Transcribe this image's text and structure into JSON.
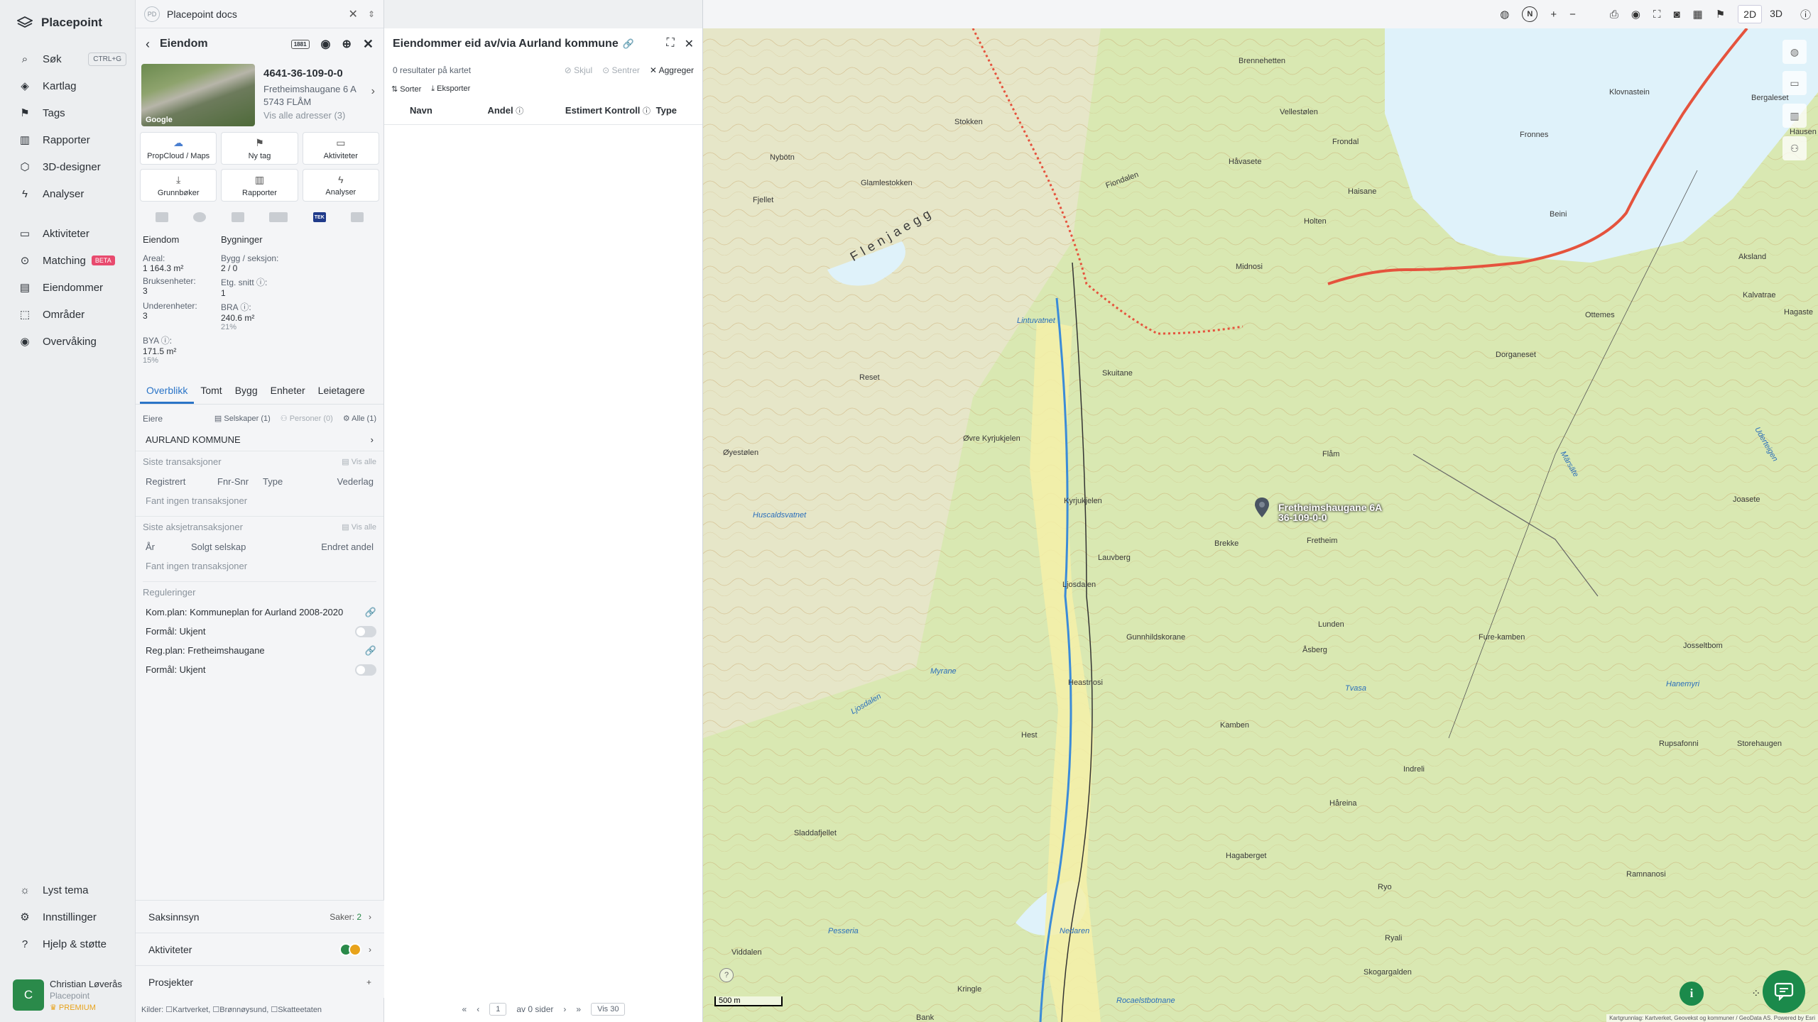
{
  "app": {
    "name": "Placepoint"
  },
  "nav": {
    "items": [
      {
        "label": "Søk",
        "shortcut": "CTRL+G"
      },
      {
        "label": "Kartlag"
      },
      {
        "label": "Tags"
      },
      {
        "label": "Rapporter"
      },
      {
        "label": "3D-designer"
      },
      {
        "label": "Analyser"
      }
    ],
    "items2": [
      {
        "label": "Aktiviteter"
      },
      {
        "label": "Matching",
        "badge": "BETA"
      },
      {
        "label": "Eiendommer"
      },
      {
        "label": "Områder"
      },
      {
        "label": "Overvåking"
      }
    ],
    "bottom": [
      {
        "label": "Lyst tema"
      },
      {
        "label": "Innstillinger"
      },
      {
        "label": "Hjelp & støtte"
      }
    ]
  },
  "user": {
    "initial": "C",
    "name": "Christian Løverås",
    "org": "Placepoint",
    "plan": "PREMIUM"
  },
  "docs": {
    "badge": "PD",
    "title": "Placepoint docs"
  },
  "property": {
    "header": "Eiendom",
    "header_badge": "1881",
    "id": "4641-36-109-0-0",
    "address": "Fretheimshaugane 6 A",
    "postal": "5743 FLÅM",
    "all_addresses": "Vis alle adresser (3)",
    "photo_credit": "Google",
    "actions": [
      {
        "label": "PropCloud / Maps",
        "icon": "cloud-icon"
      },
      {
        "label": "Ny tag",
        "icon": "bookmark-icon"
      },
      {
        "label": "Aktiviteter",
        "icon": "chat-icon"
      },
      {
        "label": "Grunnbøker",
        "icon": "download-icon"
      },
      {
        "label": "Rapporter",
        "icon": "chart-icon"
      },
      {
        "label": "Analyser",
        "icon": "analysis-icon"
      }
    ],
    "tek_label": "TEK",
    "stats": {
      "col1_title": "Eiendom",
      "col2_title": "Bygninger",
      "areal_label": "Areal:",
      "areal": "1 164.3 m²",
      "bygg_label": "Bygg / seksjon:",
      "bygg": "2 / 0",
      "bruks_label": "Bruksenheter:",
      "bruks": "3",
      "etg_label": "Etg. snitt ⓘ:",
      "etg": "1",
      "under_label": "Underenheter:",
      "under": "3",
      "bra_label": "BRA ⓘ:",
      "bra": "240.6 m²",
      "bra_pct": "21%",
      "bya_label": "BYA ⓘ:",
      "bya": "171.5 m²",
      "bya_pct": "15%"
    },
    "tabs": [
      "Overblikk",
      "Tomt",
      "Bygg",
      "Enheter",
      "Leietagere"
    ],
    "owners": {
      "label": "Eiere",
      "companies": "Selskaper (1)",
      "persons": "Personer (0)",
      "all": "Alle (1)",
      "owner": "AURLAND KOMMUNE"
    },
    "transactions": {
      "title": "Siste transaksjoner",
      "show_all": "Vis alle",
      "cols": [
        "Registrert",
        "Fnr-Snr",
        "Type",
        "Vederlag"
      ],
      "empty": "Fant ingen transaksjoner"
    },
    "share_transactions": {
      "title": "Siste aksjetransaksjoner",
      "show_all": "Vis alle",
      "cols": [
        "År",
        "Solgt selskap",
        "Endret andel"
      ],
      "empty": "Fant ingen transaksjoner"
    },
    "regulations": {
      "title": "Reguleringer",
      "items": [
        {
          "label": "Kom.plan: Kommuneplan for Aurland 2008-2020"
        },
        {
          "label": "Formål: Ukjent"
        },
        {
          "label": "Reg.plan: Fretheimshaugane"
        },
        {
          "label": "Formål: Ukjent"
        }
      ]
    },
    "accordions": {
      "saksinnsyn": "Saksinnsyn",
      "saker": "Saker:",
      "saker_count": "2",
      "aktiviteter": "Aktiviteter",
      "prosjekter": "Prosjekter"
    },
    "sources": {
      "label": "Kilder:",
      "items": [
        "Kartverket,",
        "Brønnøysund,",
        "Skatteetaten"
      ]
    }
  },
  "owned": {
    "title": "Eiendommer eid av/via Aurland kommune",
    "results": "0 resultater på kartet",
    "hide": "Skjul",
    "center": "Sentrer",
    "aggregate": "Aggreger",
    "sort": "Sorter",
    "export": "Eksporter",
    "columns": [
      "Navn",
      "Andel",
      "Estimert Kontroll",
      "Type"
    ],
    "pager": {
      "page": "1",
      "of": "av 0 sider",
      "per": "Vis 30"
    }
  },
  "topbar": {
    "north": "N",
    "mode_2d": "2D",
    "mode_3d": "3D"
  },
  "map": {
    "pin_label_1": "Fretheimshaugane 6A",
    "pin_label_2": "36-109-0-0",
    "scale": "500 m",
    "help": "?",
    "attribution": "Kartgrunnlag: Kartverket, Geovekst og kommuner / GeoData AS. Powered by Esri",
    "places": [
      "Flåm",
      "Fretheim",
      "Brekke",
      "Lunden",
      "Åsberg",
      "Kamben",
      "Indreli",
      "Håreina",
      "Hagaberget",
      "Ryo",
      "Ryali",
      "Skogargalden",
      "Flenjaegg",
      "Fiondalen",
      "Midnosi",
      "Lintuvatnet",
      "Reset",
      "Øyestølen",
      "Øvre Kyrjukjelen",
      "Kyrjukjelen",
      "Lauvberg",
      "Ljosdalen",
      "Heastnosi",
      "Hest",
      "Sladdafjellet",
      "Viddalen",
      "Kringle",
      "Bank",
      "Holten",
      "Haisane",
      "Frondal",
      "Håvasete",
      "Vellestølen",
      "Stokken",
      "Nybötn",
      "Fjellet",
      "Glamlestokken",
      "Skuitane",
      "Fronnes",
      "Dorganeset",
      "Klovnastein",
      "Bergaleset",
      "Aksland",
      "Kalvatrae",
      "Ottemes",
      "Hagaste",
      "Joasete",
      "Josseltbom",
      "Fure-kamben",
      "Rupsafonni",
      "Storehaugen",
      "Ramnanosi",
      "Gunnhildskorane",
      "Brennehetten",
      "Beini",
      "Hausen"
    ],
    "waters": [
      "Huscaldsvatnet",
      "Myrane",
      "Ljosdalen",
      "Pesseria",
      "Nedaren",
      "Rocaelstbotnane",
      "Tvasa",
      "Hanemyri",
      "Märsäte",
      "Uderteigen"
    ]
  }
}
